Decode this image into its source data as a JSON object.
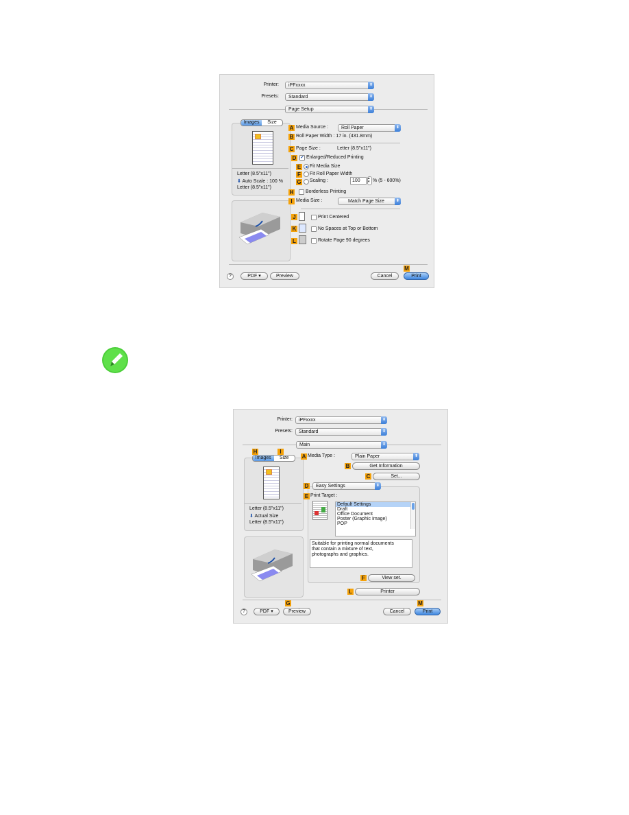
{
  "dialog1": {
    "printer_label": "Printer:",
    "printer_value": "iPFxxxx",
    "presets_label": "Presets:",
    "presets_value": "Standard",
    "panel_value": "Page Setup",
    "tabs": [
      "Images",
      "Size"
    ],
    "preview_lines": [
      "Letter (8.5\"x11\")",
      "Auto Scale : 100 %",
      "Letter (8.5\"x11\")"
    ],
    "media_source_label": "Media Source :",
    "media_source_value": "Roll Paper",
    "roll_width_text": "Roll Paper Width : 17 in. (431.8mm)",
    "page_size_label": "Page Size :",
    "page_size_value": "Letter (8.5\"x11\")",
    "enlarged_label": "Enlarged/Reduced Printing",
    "enlarged_checked": true,
    "fit_media_label": "Fit Media Size",
    "fit_roll_label": "Fit Roll Paper Width",
    "scaling_label": "Scaling :",
    "scaling_value": "100",
    "scaling_range": "% (5 - 600%)",
    "borderless_label": "Borderless Printing",
    "borderless_checked": false,
    "media_size_label": "Media Size :",
    "media_size_value": "Match Page Size",
    "print_centered_label": "Print Centered",
    "no_spaces_label": "No Spaces at Top or Bottom",
    "rotate_label": "Rotate Page 90 degrees",
    "help": "?",
    "pdf": "PDF ▾",
    "preview": "Preview",
    "cancel": "Cancel",
    "print": "Print",
    "badges": [
      "A",
      "B",
      "C",
      "D",
      "E",
      "F",
      "G",
      "H",
      "I",
      "J",
      "K",
      "L",
      "M"
    ]
  },
  "note_icon": "pencil-note-icon",
  "dialog2": {
    "printer_label": "Printer:",
    "printer_value": "iPFxxxx",
    "presets_label": "Presets:",
    "presets_value": "Standard",
    "panel_value": "Main",
    "tabs": [
      "Images",
      "Size"
    ],
    "preview_lines": [
      "Letter (8.5\"x11\")",
      "Actual Size",
      "Letter (8.5\"x11\")"
    ],
    "media_type_label": "Media Type :",
    "media_type_value": "Plain Paper",
    "get_info": "Get Information",
    "set": "Set...",
    "mode_value": "Easy Settings",
    "print_target_label": "Print Target :",
    "targets": [
      "Default Settings",
      "Draft",
      "Office Document",
      "Poster (Graphic Image)",
      "POP"
    ],
    "description": "Suitable for printing normal documents that contain a mixture of text, photographs and graphics.",
    "view_set": "View set.",
    "printer_button": "Printer",
    "help": "?",
    "pdf": "PDF ▾",
    "preview": "Preview",
    "cancel": "Cancel",
    "print": "Print",
    "badges": [
      "A",
      "B",
      "C",
      "D",
      "E",
      "F",
      "G",
      "H",
      "I",
      "L",
      "M"
    ]
  }
}
